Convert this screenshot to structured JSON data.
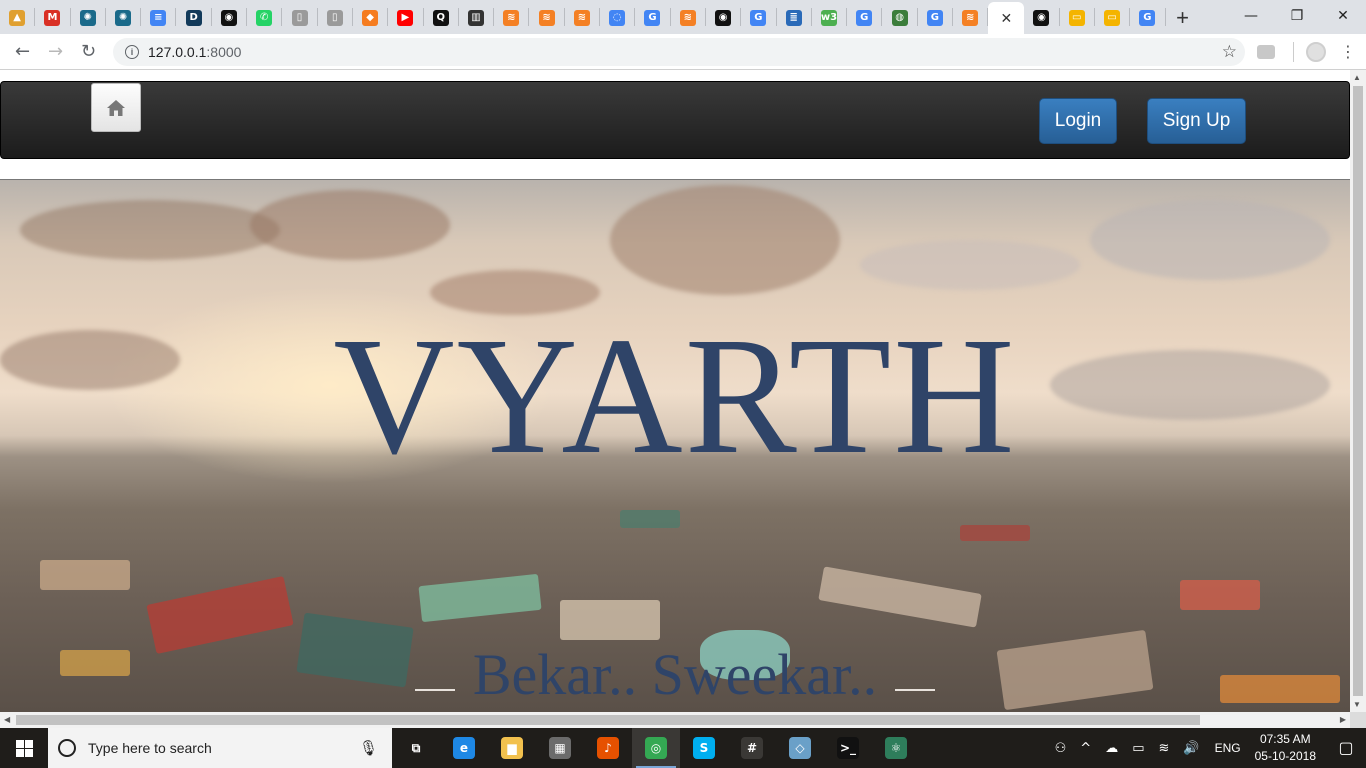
{
  "browser": {
    "tabs": [
      {
        "name": "tab-favicon-1",
        "glyph": "▲",
        "color": "#e0a030"
      },
      {
        "name": "tab-gmail",
        "glyph": "M",
        "color": "#d93025"
      },
      {
        "name": "tab-favicon-3",
        "glyph": "✺",
        "color": "#1a6a8a"
      },
      {
        "name": "tab-favicon-4",
        "glyph": "✺",
        "color": "#1a6a8a"
      },
      {
        "name": "tab-docs",
        "glyph": "≡",
        "color": "#4285f4"
      },
      {
        "name": "tab-favicon-d",
        "glyph": "D",
        "color": "#123a5a"
      },
      {
        "name": "tab-github-1",
        "glyph": "◉",
        "color": "#111111"
      },
      {
        "name": "tab-whatsapp",
        "glyph": "✆",
        "color": "#25d366"
      },
      {
        "name": "tab-blank-1",
        "glyph": "▯",
        "color": "#9a9a9a"
      },
      {
        "name": "tab-blank-2",
        "glyph": "▯",
        "color": "#9a9a9a"
      },
      {
        "name": "tab-favicon-orange",
        "glyph": "◆",
        "color": "#f57c1f"
      },
      {
        "name": "tab-youtube",
        "glyph": "▶",
        "color": "#ff0000"
      },
      {
        "name": "tab-favicon-q",
        "glyph": "Q",
        "color": "#111111"
      },
      {
        "name": "tab-favicon-book",
        "glyph": "▥",
        "color": "#333333"
      },
      {
        "name": "tab-stackoverflow-1",
        "glyph": "≋",
        "color": "#f48024"
      },
      {
        "name": "tab-stackoverflow-2",
        "glyph": "≋",
        "color": "#f48024"
      },
      {
        "name": "tab-stackoverflow-3",
        "glyph": "≋",
        "color": "#f48024"
      },
      {
        "name": "tab-favicon-loop",
        "glyph": "◌",
        "color": "#4285f4"
      },
      {
        "name": "tab-google-1",
        "glyph": "G",
        "color": "#4285f4"
      },
      {
        "name": "tab-stackoverflow-4",
        "glyph": "≋",
        "color": "#f48024"
      },
      {
        "name": "tab-github-2",
        "glyph": "◉",
        "color": "#111111"
      },
      {
        "name": "tab-google-2",
        "glyph": "G",
        "color": "#4285f4"
      },
      {
        "name": "tab-favicon-stack",
        "glyph": "≣",
        "color": "#2a6ab8"
      },
      {
        "name": "tab-favicon-w3",
        "glyph": "w3",
        "color": "#4caf50"
      },
      {
        "name": "tab-google-3",
        "glyph": "G",
        "color": "#4285f4"
      },
      {
        "name": "tab-favicon-globe",
        "glyph": "◍",
        "color": "#3b7d3b"
      },
      {
        "name": "tab-google-4",
        "glyph": "G",
        "color": "#4285f4"
      },
      {
        "name": "tab-stackoverflow-5",
        "glyph": "≋",
        "color": "#f48024"
      }
    ],
    "active_tab_close": "✕",
    "tabs_after": [
      {
        "name": "tab-github-3",
        "glyph": "◉",
        "color": "#111111"
      },
      {
        "name": "tab-slides-1",
        "glyph": "▭",
        "color": "#f4b400"
      },
      {
        "name": "tab-slides-2",
        "glyph": "▭",
        "color": "#f4b400"
      },
      {
        "name": "tab-google-5",
        "glyph": "G",
        "color": "#4285f4"
      }
    ],
    "new_tab": "+",
    "window_controls": {
      "minimize": "—",
      "maximize": "❐",
      "close": "✕"
    },
    "nav": {
      "back": "←",
      "forward": "→",
      "reload": "↻"
    },
    "address": {
      "host": "127.0.0.1",
      "port": ":8000",
      "info": "i",
      "star": "☆"
    },
    "menu": "⋮"
  },
  "site": {
    "home_icon": "home-icon",
    "login_label": "Login",
    "signup_label": "Sign Up",
    "hero_title": "VYARTH",
    "hero_subtitle": "Bekar.. Sweekar.."
  },
  "taskbar": {
    "search_placeholder": "Type here to search",
    "mic": "🎙",
    "apps": [
      {
        "name": "task-view-icon",
        "glyph": "⧉",
        "color": "transparent"
      },
      {
        "name": "edge-icon",
        "glyph": "e",
        "color": "#1e88e5"
      },
      {
        "name": "file-explorer-icon",
        "glyph": "▆",
        "color": "#f2c14e"
      },
      {
        "name": "store-icon",
        "glyph": "▦",
        "color": "#6b6b6b"
      },
      {
        "name": "media-player-icon",
        "glyph": "♪",
        "color": "#e65100"
      },
      {
        "name": "chrome-icon",
        "glyph": "◎",
        "color": "#34a853"
      },
      {
        "name": "skype-icon",
        "glyph": "S",
        "color": "#00aff0"
      },
      {
        "name": "slack-icon",
        "glyph": "#",
        "color": "#3a3835"
      },
      {
        "name": "notes-icon",
        "glyph": "◇",
        "color": "#6aa0c8"
      },
      {
        "name": "terminal-icon",
        "glyph": ">_",
        "color": "#111111"
      },
      {
        "name": "atom-icon",
        "glyph": "⚛",
        "color": "#2e7d5b"
      }
    ],
    "tray": {
      "people": "⚇",
      "chevron": "^",
      "cloud": "☁",
      "battery": "▭",
      "wifi": "≋",
      "volume": "🔊",
      "lang": "ENG",
      "time": "07:35 AM",
      "date": "05-10-2018",
      "notifications": "▢"
    }
  }
}
